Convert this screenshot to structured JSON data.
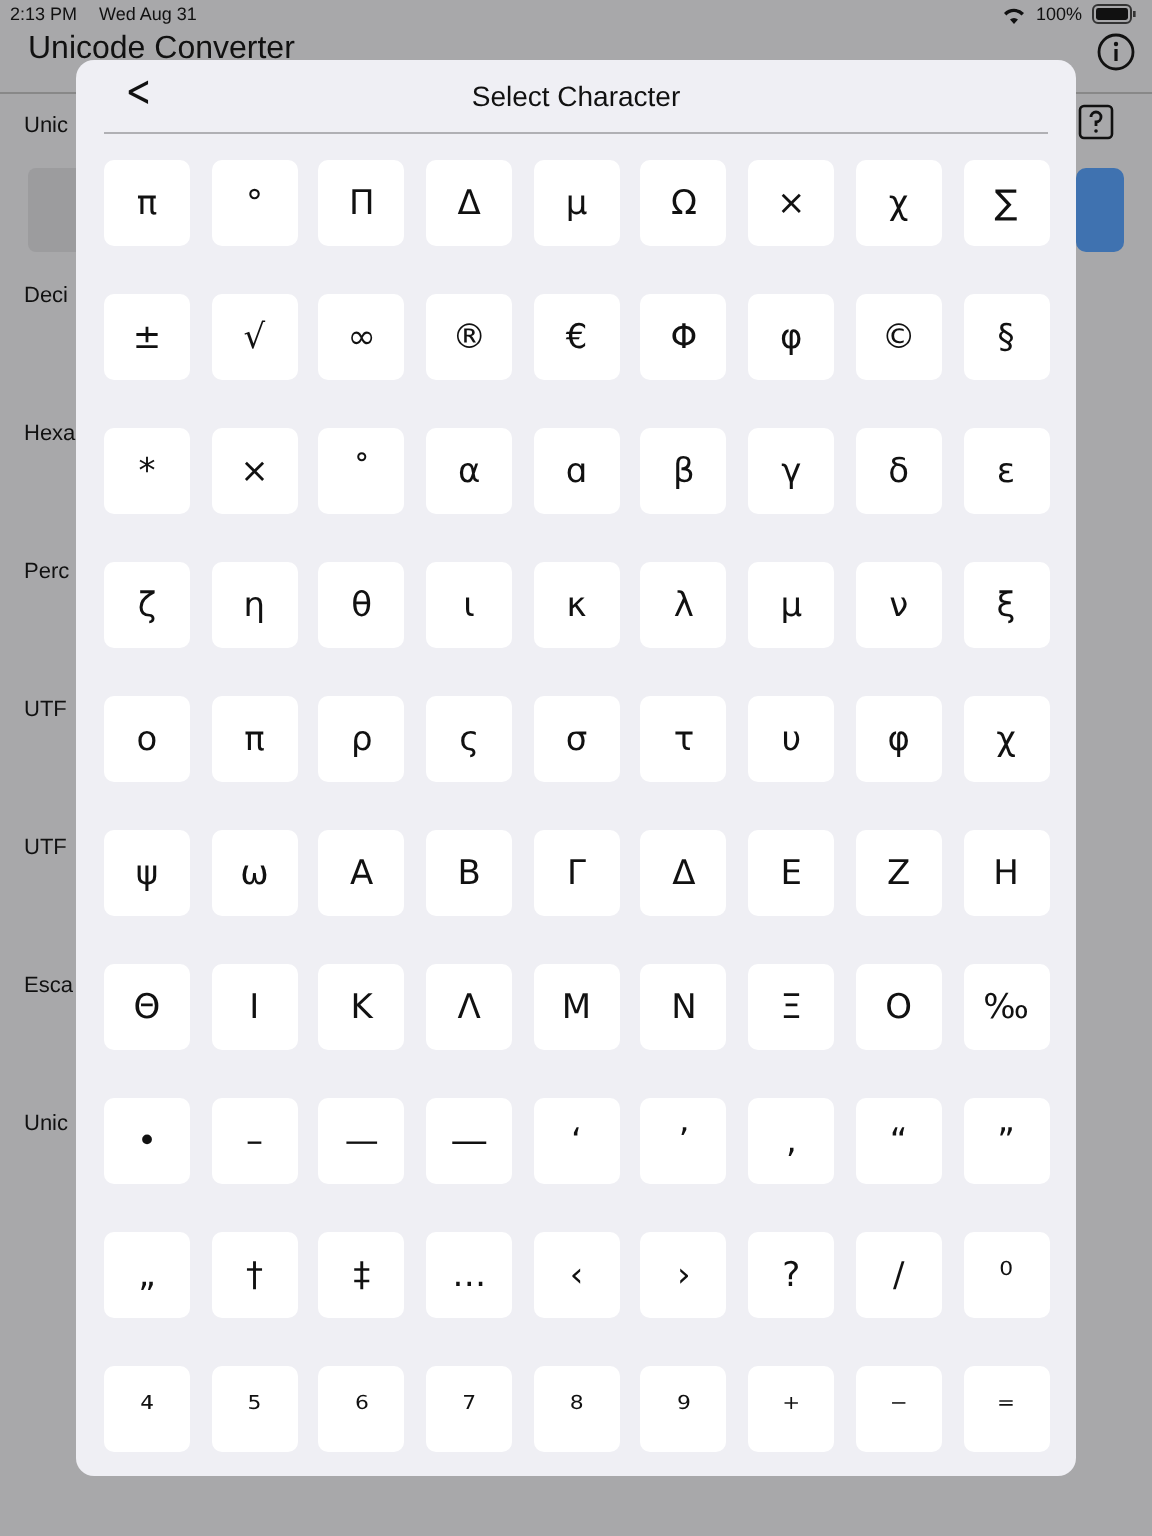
{
  "status_bar": {
    "time": "2:13 PM",
    "date": "Wed Aug 31",
    "battery": "100%"
  },
  "background": {
    "title": "Unicode Converter",
    "labels": [
      "Unic",
      "Deci",
      "Hexa",
      "Perc",
      "UTF",
      "UTF",
      "Esca",
      "Unic"
    ]
  },
  "dialog": {
    "back": "<",
    "title": "Select Character",
    "characters": [
      "π",
      "°",
      "Π",
      "Δ",
      "µ",
      "Ω",
      "×",
      "χ",
      "∑",
      "±",
      "√",
      "∞",
      "®",
      "€",
      "Φ",
      "φ",
      "©",
      "§",
      "*",
      "×",
      "˚",
      "α",
      "ɑ",
      "β",
      "γ",
      "δ",
      "ε",
      "ζ",
      "η",
      "θ",
      "ι",
      "κ",
      "λ",
      "μ",
      "ν",
      "ξ",
      "ο",
      "π",
      "ρ",
      "ς",
      "σ",
      "τ",
      "υ",
      "φ",
      "χ",
      "ψ",
      "ω",
      "Α",
      "Β",
      "Γ",
      "Δ",
      "Ε",
      "Ζ",
      "Η",
      "Θ",
      "Ι",
      "Κ",
      "Λ",
      "Μ",
      "Ν",
      "Ξ",
      "Ο",
      "‰",
      "•",
      "–",
      "—",
      "―",
      "‘",
      "’",
      "‚",
      "“",
      "”",
      "„",
      "†",
      "‡",
      "…",
      "‹",
      "›",
      "?",
      "/",
      "⁰",
      "⁴",
      "⁵",
      "⁶",
      "⁷",
      "⁸",
      "⁹",
      "⁺",
      "⁻",
      "⁼"
    ]
  }
}
